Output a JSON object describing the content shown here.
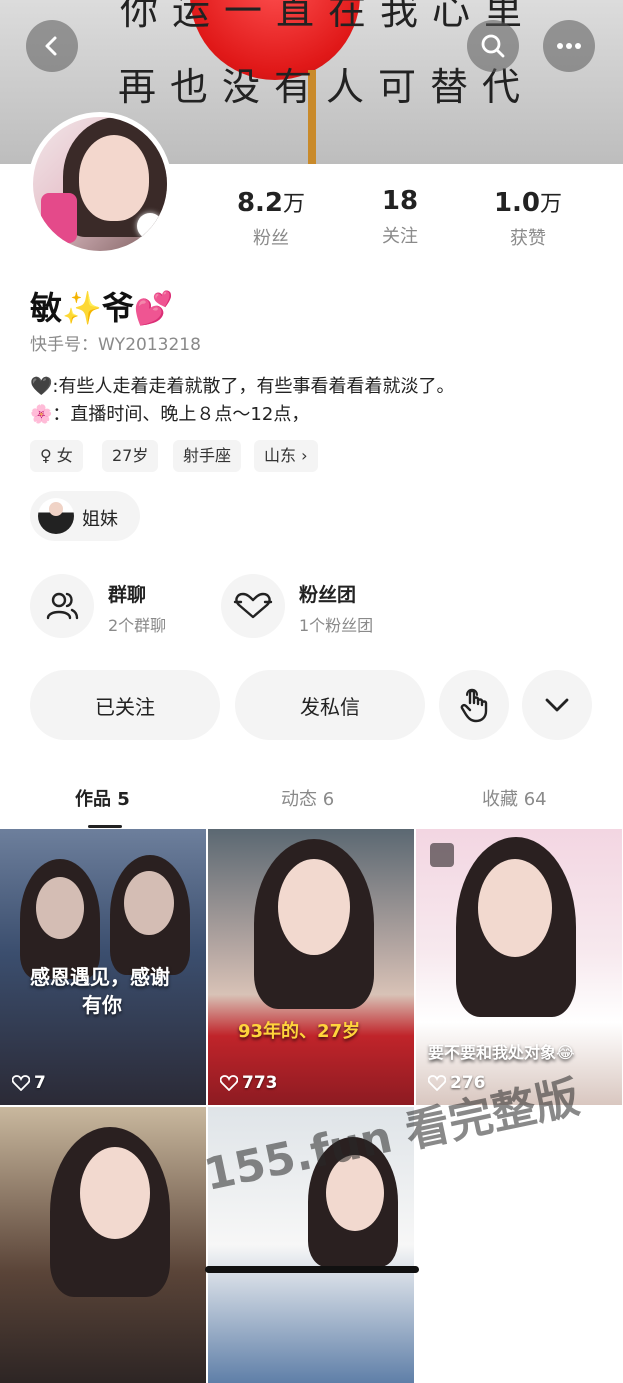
{
  "banner": {
    "line1": "你运一直在我心里",
    "line2": "再也没有人可替代"
  },
  "header": {
    "back_icon": "back-arrow-icon",
    "search_icon": "search-icon",
    "more_icon": "more-dots-icon"
  },
  "stats": [
    {
      "num": "8.2",
      "unit": "万",
      "label": "粉丝"
    },
    {
      "num": "18",
      "unit": "",
      "label": "关注"
    },
    {
      "num": "1.0",
      "unit": "万",
      "label": "获赞"
    }
  ],
  "profile": {
    "name": "敏✨爷💕",
    "kuaishou_id": "快手号：WY2013218",
    "bio_line1": "🖤:有些人走着走着就散了，有些事看着看着就淡了。",
    "bio_line2": "🌸：直播时间、晚上８点～12点，"
  },
  "tags": [
    {
      "label": "♀ 女"
    },
    {
      "label": "27岁"
    },
    {
      "label": "射手座"
    },
    {
      "label": "山东 ›"
    }
  ],
  "relation": {
    "label": "姐妹"
  },
  "groups": [
    {
      "title": "群聊",
      "sub": "2个群聊",
      "icon": "group-chat-icon"
    },
    {
      "title": "粉丝团",
      "sub": "1个粉丝团",
      "icon": "fan-club-heart-icon"
    }
  ],
  "actions": {
    "follow_label": "已关注",
    "message_label": "发私信",
    "gesture_icon": "tap-hand-icon",
    "more_icon": "chevron-down-icon"
  },
  "tabs": [
    {
      "label": "作品 5",
      "active": true
    },
    {
      "label": "动态 6",
      "active": false
    },
    {
      "label": "收藏 64",
      "active": false
    }
  ],
  "works": [
    {
      "likes": "7",
      "caption_line1": "感恩遇见，感谢",
      "caption_line2": "有你"
    },
    {
      "likes": "773",
      "caption": "93年的、27岁"
    },
    {
      "likes": "276",
      "caption": "要不要和我处对象😂"
    },
    {
      "likes": ""
    },
    {
      "likes": ""
    }
  ],
  "watermark": "155.fun 看完整版",
  "colors": {
    "accent_text": "#222222",
    "muted_text": "#8a8a8a",
    "pill_bg": "#f4f4f4"
  }
}
